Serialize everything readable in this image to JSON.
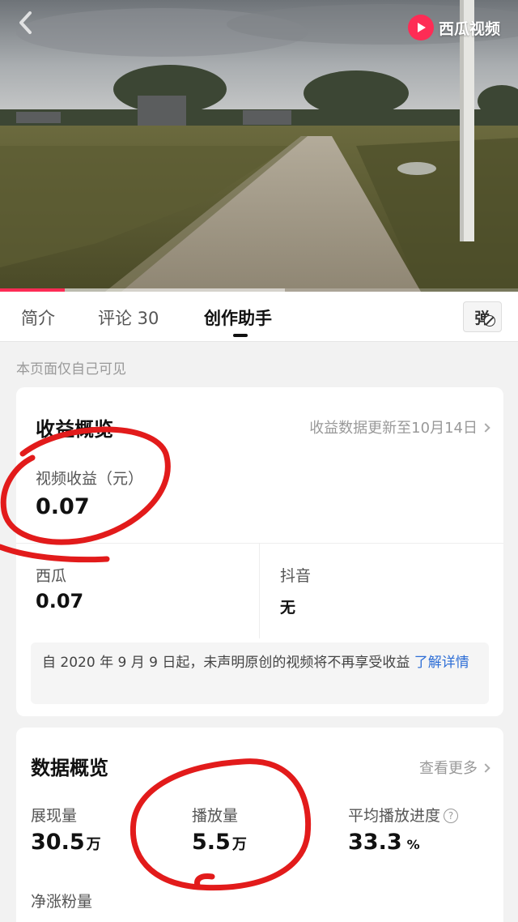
{
  "video": {
    "brand_name": "西瓜视频",
    "progress": 0.125
  },
  "tabs": [
    {
      "label": "简介"
    },
    {
      "label": "评论 30"
    },
    {
      "label": "创作助手"
    }
  ],
  "danmu_label": "弹",
  "visible_note": "本页面仅自己可见",
  "earnings": {
    "title": "收益概览",
    "update_text": "收益数据更新至10月14日",
    "video_earnings_label": "视频收益（元）",
    "video_earnings_value": "0.07",
    "xigua_label": "西瓜",
    "xigua_value": "0.07",
    "douyin_label": "抖音",
    "douyin_value": "无",
    "notice_text": "自 2020 年 9 月 9 日起，未声明原创的视频将不再享受收益 ",
    "notice_link": "了解详情"
  },
  "data_overview": {
    "title": "数据概览",
    "more_label": "查看更多",
    "impressions_label": "展现量",
    "impressions_value": "30.5",
    "impressions_unit": "万",
    "plays_label": "播放量",
    "plays_value": "5.5",
    "plays_unit": "万",
    "avg_progress_label": "平均播放进度",
    "avg_progress_value": "33.3",
    "avg_progress_unit": "%",
    "net_followers_label": "净涨粉量",
    "help_glyph": "?"
  },
  "colors": {
    "accent": "#fe2c55",
    "link": "#2f6fd6",
    "annotation": "#e21b1b"
  }
}
